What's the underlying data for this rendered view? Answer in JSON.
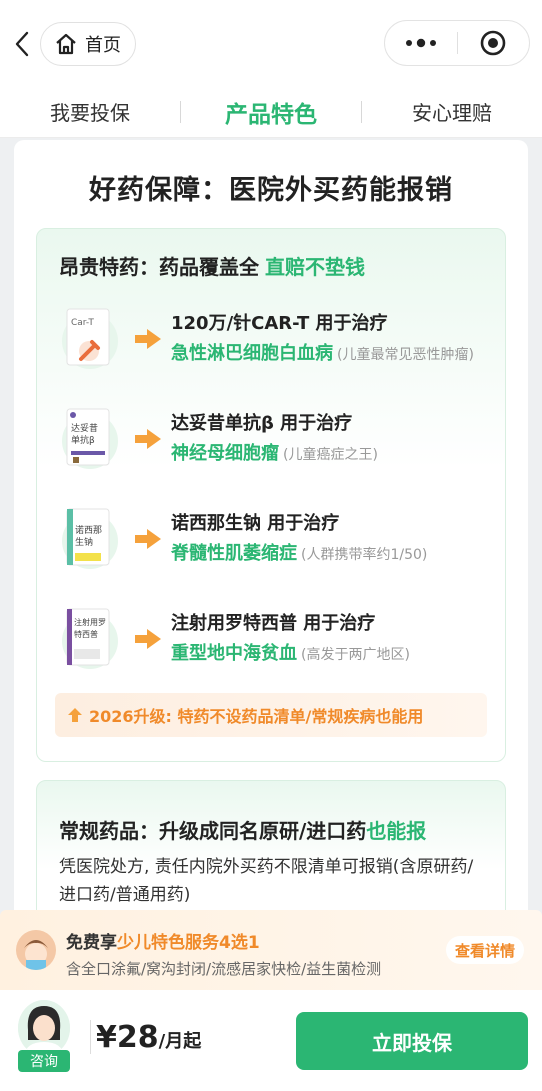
{
  "nav": {
    "home_label": "首页"
  },
  "tabs": [
    {
      "label": "我要投保",
      "active": false
    },
    {
      "label": "产品特色",
      "active": true
    },
    {
      "label": "安心理赔",
      "active": false
    }
  ],
  "section": {
    "title": "好药保障：医院外买药能报销",
    "special_drugs": {
      "title": "昂贵特药：药品覆盖全",
      "highlight": "直赔不垫钱",
      "items": [
        {
          "icon_label": "Car-T",
          "line1": "120万/针CAR-T 用于治疗",
          "disease": "急性淋巴细胞白血病",
          "note": "(儿童最常见恶性肿瘤)"
        },
        {
          "icon_label": "达妥昔单抗β",
          "line1": "达妥昔单抗β 用于治疗",
          "disease": "神经母细胞瘤",
          "note": "(儿童癌症之王)"
        },
        {
          "icon_label": "诺西那生钠",
          "line1": "诺西那生钠 用于治疗",
          "disease": "脊髓性肌萎缩症",
          "note": "(人群携带率约1/50)"
        },
        {
          "icon_label": "注射用罗特西普",
          "line1": "注射用罗特西普 用于治疗",
          "disease": "重型地中海贫血",
          "note": "(高发于两广地区)"
        }
      ],
      "upgrade": "2026升级: 特药不设药品清单/常规疾病也能用"
    },
    "regular_drugs": {
      "title": "常规药品：升级成同名原研/进口药",
      "highlight": "也能报",
      "body": "凭医院处方, 责任内院外买药不限清单可报销(含原研药/进口药/普通用药)"
    }
  },
  "promo": {
    "prefix": "免费享",
    "highlight": "少儿特色服务4选1",
    "desc": "含全口涂氟/窝沟封闭/流感居家快检/益生菌检测",
    "button": "查看详情"
  },
  "bottom": {
    "consult_label": "咨询",
    "price": "¥28",
    "price_unit": "/月起",
    "cta": "立即投保"
  },
  "colors": {
    "brand": "#2bb673",
    "accent": "#f08a2a"
  }
}
